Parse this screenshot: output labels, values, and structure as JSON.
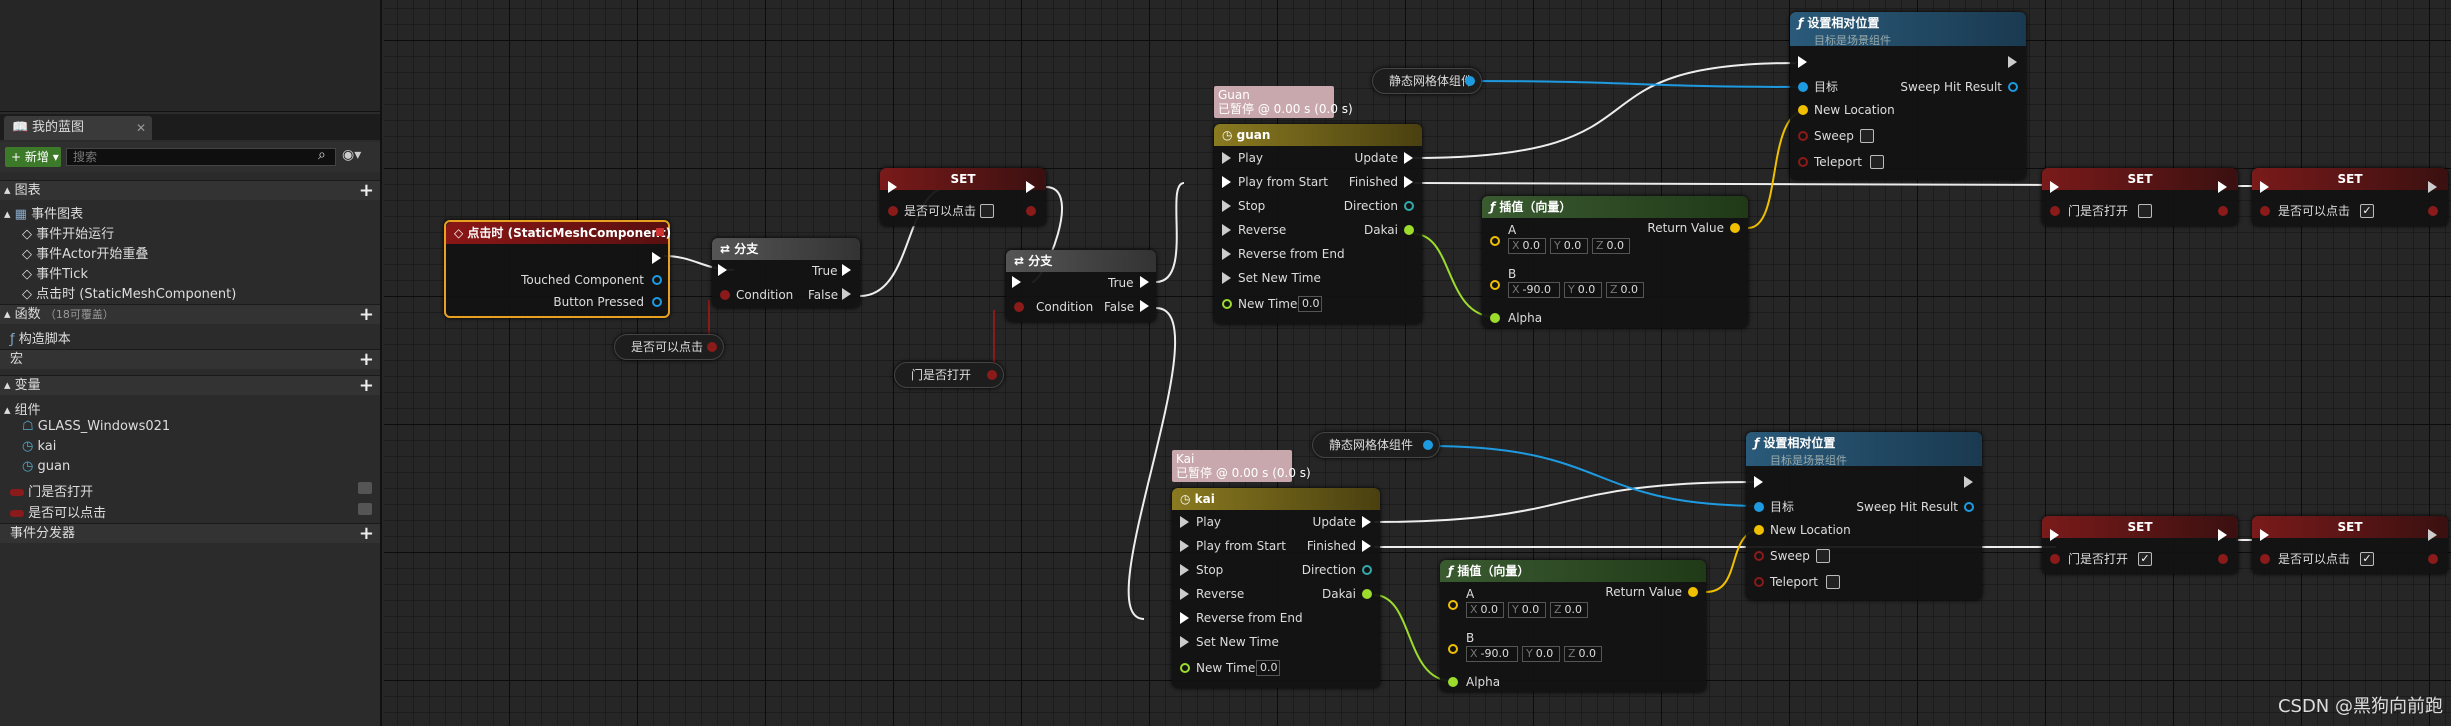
{
  "sidebar": {
    "tab_label": "我的蓝图",
    "add_label": "新增",
    "search_placeholder": "搜索",
    "sections": {
      "graphs": "图表",
      "event_graph": "事件图表",
      "functions": "函数",
      "functions_hint": "（18可覆盖）",
      "macros": "宏",
      "variables": "变量",
      "components": "组件",
      "dispatchers": "事件分发器"
    },
    "events": [
      "事件开始运行",
      "事件Actor开始重叠",
      "事件Tick",
      "点击时 (StaticMeshComponent)"
    ],
    "construct": "构造脚本",
    "components": [
      "GLASS_Windows021",
      "kai",
      "guan"
    ],
    "variables": [
      {
        "label": "门是否打开",
        "color": "#8b1a1a"
      },
      {
        "label": "是否可以点击",
        "color": "#8b1a1a"
      }
    ]
  },
  "graph": {
    "event_node": {
      "title": "点击时 (StaticMeshComponent)",
      "pin1": "Touched Component",
      "pin2": "Button Pressed"
    },
    "branch": {
      "title": "分支",
      "cond": "Condition",
      "true": "True",
      "false": "False"
    },
    "set": {
      "title": "SET"
    },
    "var_clickable": "是否可以点击",
    "var_door_open": "门是否打开",
    "static_mesh": "静态网格体组件",
    "timeline_guan": {
      "title": "guan",
      "comment_line1": "Guan",
      "comment_line2": "已暂停 @ 0.00 s (0.0 s)",
      "inputs": [
        "Play",
        "Play from Start",
        "Stop",
        "Reverse",
        "Reverse from End",
        "Set New Time"
      ],
      "outputs": [
        "Update",
        "Finished",
        "Direction",
        "Dakai"
      ],
      "new_time_label": "New Time",
      "new_time_value": "0.0"
    },
    "timeline_kai": {
      "title": "kai",
      "comment_line1": "Kai",
      "comment_line2": "已暂停 @ 0.00 s (0.0 s)"
    },
    "set_rel": {
      "title": "设置相对位置",
      "subtitle": "目标是场景组件",
      "target": "目标",
      "sweep_hit": "Sweep Hit Result",
      "new_location": "New Location",
      "sweep": "Sweep",
      "teleport": "Teleport"
    },
    "lerp": {
      "title": "插值（向量）",
      "a": "A",
      "b": "B",
      "alpha": "Alpha",
      "return": "Return Value",
      "a_vals": [
        "0.0",
        "0.0",
        "0.0"
      ],
      "b_vals": [
        "-90.0",
        "0.0",
        "0.0"
      ],
      "axis_x": "X",
      "axis_y": "Y",
      "axis_z": "Z"
    }
  },
  "watermark": "CSDN @黑狗向前跑"
}
